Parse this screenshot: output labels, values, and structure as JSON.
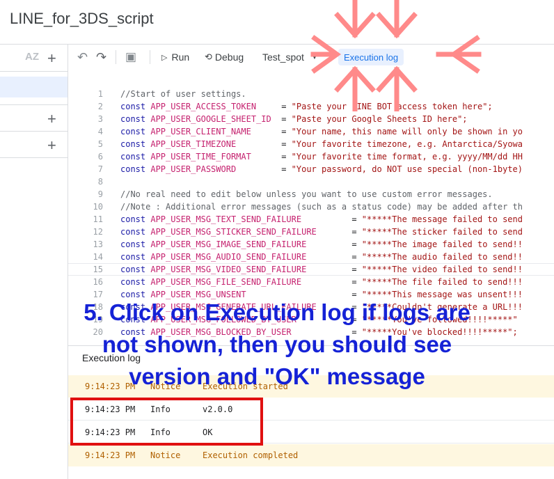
{
  "app": {
    "title": "LINE_for_3DS_script"
  },
  "sidebar": {
    "sort_icon": "AZ"
  },
  "toolbar": {
    "run_label": "Run",
    "debug_label": "Debug",
    "function_select": "Test_spot",
    "exec_log_label": "Execution log"
  },
  "code_lines": [
    {
      "n": "1",
      "parts": [
        {
          "c": "cm",
          "t": "//Start of user settings."
        }
      ]
    },
    {
      "n": "2",
      "parts": [
        {
          "c": "kw",
          "t": "const "
        },
        {
          "c": "vr",
          "t": "APP_USER_ACCESS_TOKEN     "
        },
        {
          "c": "",
          "t": "= "
        },
        {
          "c": "st",
          "t": "\"Paste your LINE BOT access token here\";"
        }
      ]
    },
    {
      "n": "3",
      "parts": [
        {
          "c": "kw",
          "t": "const "
        },
        {
          "c": "vr",
          "t": "APP_USER_GOOGLE_SHEET_ID  "
        },
        {
          "c": "",
          "t": "= "
        },
        {
          "c": "st",
          "t": "\"Paste your Google Sheets ID here\";"
        }
      ]
    },
    {
      "n": "4",
      "parts": [
        {
          "c": "kw",
          "t": "const "
        },
        {
          "c": "vr",
          "t": "APP_USER_CLIENT_NAME      "
        },
        {
          "c": "",
          "t": "= "
        },
        {
          "c": "st",
          "t": "\"Your name, this name will only be shown in yo"
        }
      ]
    },
    {
      "n": "5",
      "parts": [
        {
          "c": "kw",
          "t": "const "
        },
        {
          "c": "vr",
          "t": "APP_USER_TIMEZONE         "
        },
        {
          "c": "",
          "t": "= "
        },
        {
          "c": "st",
          "t": "\"Your favorite timezone, e.g. Antarctica/Syowa"
        }
      ]
    },
    {
      "n": "6",
      "parts": [
        {
          "c": "kw",
          "t": "const "
        },
        {
          "c": "vr",
          "t": "APP_USER_TIME_FORMAT      "
        },
        {
          "c": "",
          "t": "= "
        },
        {
          "c": "st",
          "t": "\"Your favorite time format, e.g. yyyy/MM/dd HH"
        }
      ]
    },
    {
      "n": "7",
      "parts": [
        {
          "c": "kw",
          "t": "const "
        },
        {
          "c": "vr",
          "t": "APP_USER_PASSWORD         "
        },
        {
          "c": "",
          "t": "= "
        },
        {
          "c": "st",
          "t": "\"Your password, do NOT use special (non-1byte)"
        }
      ]
    },
    {
      "n": "8",
      "parts": []
    },
    {
      "n": "9",
      "parts": [
        {
          "c": "cm",
          "t": "//No real need to edit below unless you want to use custom error messages."
        }
      ]
    },
    {
      "n": "10",
      "parts": [
        {
          "c": "cm",
          "t": "//Note : Additional error messages (such as a status code) may be added after th"
        }
      ]
    },
    {
      "n": "11",
      "parts": [
        {
          "c": "kw",
          "t": "const "
        },
        {
          "c": "vr",
          "t": "APP_USER_MSG_TEXT_SEND_FAILURE          "
        },
        {
          "c": "",
          "t": "= "
        },
        {
          "c": "st",
          "t": "\"*****The message failed to send"
        }
      ]
    },
    {
      "n": "12",
      "parts": [
        {
          "c": "kw",
          "t": "const "
        },
        {
          "c": "vr",
          "t": "APP_USER_MSG_STICKER_SEND_FAILURE       "
        },
        {
          "c": "",
          "t": "= "
        },
        {
          "c": "st",
          "t": "\"*****The sticker failed to send"
        }
      ]
    },
    {
      "n": "13",
      "parts": [
        {
          "c": "kw",
          "t": "const "
        },
        {
          "c": "vr",
          "t": "APP_USER_MSG_IMAGE_SEND_FAILURE         "
        },
        {
          "c": "",
          "t": "= "
        },
        {
          "c": "st",
          "t": "\"*****The image failed to send!!"
        }
      ]
    },
    {
      "n": "14",
      "parts": [
        {
          "c": "kw",
          "t": "const "
        },
        {
          "c": "vr",
          "t": "APP_USER_MSG_AUDIO_SEND_FAILURE         "
        },
        {
          "c": "",
          "t": "= "
        },
        {
          "c": "st",
          "t": "\"*****The audio failed to send!!"
        }
      ]
    },
    {
      "n": "15",
      "parts": [
        {
          "c": "kw",
          "t": "const "
        },
        {
          "c": "vr",
          "t": "APP_USER_MSG_VIDEO_SEND_FAILURE         "
        },
        {
          "c": "",
          "t": "= "
        },
        {
          "c": "st",
          "t": "\"*****The video failed to send!!"
        }
      ]
    },
    {
      "n": "16",
      "parts": [
        {
          "c": "kw",
          "t": "const "
        },
        {
          "c": "vr",
          "t": "APP_USER_MSG_FILE_SEND_FAILURE          "
        },
        {
          "c": "",
          "t": "= "
        },
        {
          "c": "st",
          "t": "\"*****The file failed to send!!!"
        }
      ]
    },
    {
      "n": "17",
      "parts": [
        {
          "c": "kw",
          "t": "const "
        },
        {
          "c": "vr",
          "t": "APP_USER_MSG_UNSENT                     "
        },
        {
          "c": "",
          "t": "= "
        },
        {
          "c": "st",
          "t": "\"*****This message was unsent!!!"
        }
      ]
    },
    {
      "n": "18",
      "parts": [
        {
          "c": "kw",
          "t": "const "
        },
        {
          "c": "vr",
          "t": "APP_USER_MSG_GENERATE_URL_FAILURE       "
        },
        {
          "c": "",
          "t": "= "
        },
        {
          "c": "st",
          "t": "\"*****Couldn't generate a URL!!!"
        }
      ]
    },
    {
      "n": "19",
      "parts": [
        {
          "c": "kw",
          "t": "const "
        },
        {
          "c": "vr",
          "t": "APP_USER_MSG_FOLLOWED_BY_USER           "
        },
        {
          "c": "",
          "t": "= "
        },
        {
          "c": "st",
          "t": "\"*****You've followed!!!!*****\""
        }
      ]
    },
    {
      "n": "20",
      "parts": [
        {
          "c": "kw",
          "t": "const "
        },
        {
          "c": "vr",
          "t": "APP_USER_MSG_BLOCKED_BY_USER            "
        },
        {
          "c": "",
          "t": "= "
        },
        {
          "c": "st",
          "t": "\"*****You've blocked!!!!*****\";"
        }
      ]
    }
  ],
  "exec_log": {
    "title": "Execution log",
    "rows": [
      {
        "time": "9:14:23 PM",
        "level": "Notice",
        "msg": "Execution started",
        "kind": "warn"
      },
      {
        "time": "9:14:23 PM",
        "level": "Info",
        "msg": "v2.0.0",
        "kind": "info"
      },
      {
        "time": "9:14:23 PM",
        "level": "Info",
        "msg": "OK",
        "kind": "info"
      },
      {
        "time": "9:14:23 PM",
        "level": "Notice",
        "msg": "Execution completed",
        "kind": "warn"
      }
    ]
  },
  "annotation": {
    "lines": [
      "5. Click on Execution log if logs are",
      "not shown, then you should see",
      "version and \"OK\" message"
    ],
    "color": "#1522d6",
    "arrow_color": "#ff8a8a",
    "box_color": "#e01010"
  }
}
